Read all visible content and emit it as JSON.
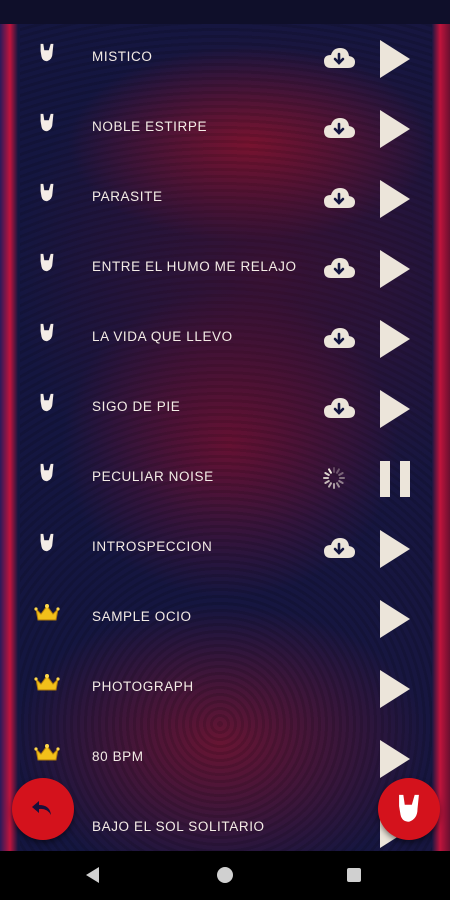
{
  "tracks": [
    {
      "title": "MISTICO",
      "icon": "hand-horns-icon",
      "status": "download"
    },
    {
      "title": "NOBLE ESTIRPE",
      "icon": "hand-horns-icon",
      "status": "download"
    },
    {
      "title": "PARASITE",
      "icon": "hand-horns-icon",
      "status": "download"
    },
    {
      "title": "ENTRE EL HUMO ME RELAJO",
      "icon": "hand-horns-icon",
      "status": "download"
    },
    {
      "title": "LA VIDA QUE LLEVO",
      "icon": "hand-horns-icon",
      "status": "download"
    },
    {
      "title": "SIGO DE PIE",
      "icon": "hand-horns-icon",
      "status": "download"
    },
    {
      "title": "PECULIAR NOISE",
      "icon": "hand-horns-icon",
      "status": "loading"
    },
    {
      "title": "INTROSPECCION",
      "icon": "hand-horns-icon",
      "status": "download"
    },
    {
      "title": "SAMPLE OCIO",
      "icon": "crown-icon",
      "status": "none"
    },
    {
      "title": "PHOTOGRAPH",
      "icon": "crown-icon",
      "status": "none"
    },
    {
      "title": "80 BPM",
      "icon": "crown-icon",
      "status": "none"
    },
    {
      "title": "BAJO EL SOL SOLITARIO",
      "icon": "crown-icon",
      "status": "none"
    }
  ],
  "fab_left": {
    "icon": "reply-arrow-icon"
  },
  "fab_right": {
    "icon": "hand-horns-icon"
  },
  "colors": {
    "accent": "#d4121c",
    "text": "#f4ece6",
    "play": "#ece5da",
    "crown": "#f2c01a"
  },
  "navbar": {
    "back_icon": "nav-back-icon",
    "home_icon": "nav-home-icon",
    "recent_icon": "nav-recent-icon"
  }
}
